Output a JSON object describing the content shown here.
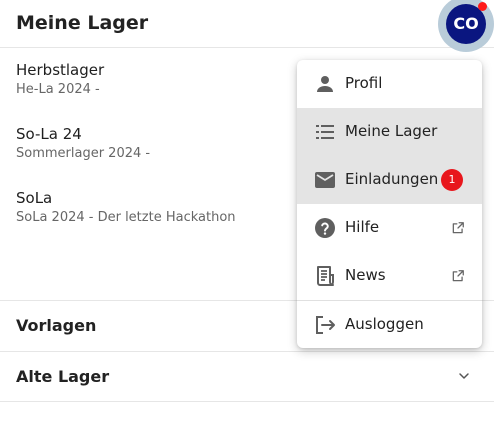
{
  "header": {
    "title": "Meine Lager",
    "avatar_initials": "CO"
  },
  "camps": [
    {
      "name": "Herbstlager",
      "subtitle": "He-La 2024 -"
    },
    {
      "name": "So-La 24",
      "subtitle": "Sommerlager 2024 -"
    },
    {
      "name": "SoLa",
      "subtitle": "SoLa 2024 - Der letzte Hackathon"
    }
  ],
  "sections": {
    "templates": "Vorlagen",
    "old_camps": "Alte Lager"
  },
  "menu": {
    "profile": "Profil",
    "my_camps": "Meine Lager",
    "invitations": "Einladungen",
    "invitations_badge": "1",
    "help": "Hilfe",
    "news": "News",
    "logout": "Ausloggen"
  },
  "colors": {
    "avatar": "#0a1680",
    "badge": "#e8161c",
    "highlight": "#e4e4e4"
  }
}
